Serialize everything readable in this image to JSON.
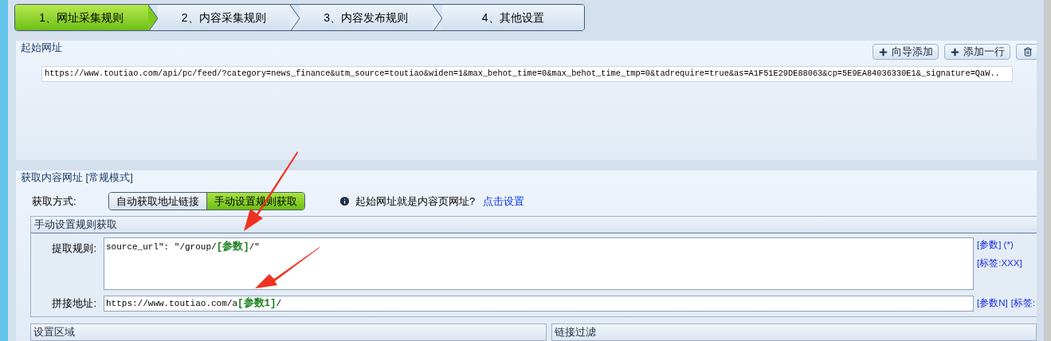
{
  "tabs": [
    {
      "label": "1、网址采集规则",
      "selected": true
    },
    {
      "label": "2、内容采集规则",
      "selected": false
    },
    {
      "label": "3、内容发布规则",
      "selected": false
    },
    {
      "label": "4、其他设置",
      "selected": false
    }
  ],
  "start_urls": {
    "title": "起始网址",
    "buttons": [
      {
        "label": "向导添加",
        "kind": "add"
      },
      {
        "label": "添加一行",
        "kind": "add"
      },
      {
        "kind": "delete"
      }
    ],
    "urls": [
      "https://www.toutiao.com/api/pc/feed/?category=news_finance&utm_source=toutiao&widen=1&max_behot_time=0&max_behot_time_tmp=0&tadrequire=true&as=A1F51E29DE88063&cp=5E9EA84036330E1&_signature=QaW.."
    ]
  },
  "content_urls": {
    "title": "获取内容网址 [常规模式]",
    "method_label": "获取方式:",
    "methods": [
      {
        "label": "自动获取地址链接",
        "selected": false
      },
      {
        "label": "手动设置规则获取",
        "selected": true
      }
    ],
    "hint": "起始网址就是内容页网址?",
    "hint_link": "点击设置",
    "manual": {
      "title": "手动设置规则获取",
      "rule_label": "提取规则:",
      "rule_value": "source_url\": \"/group/**[参数]**/\"",
      "rule_links": [
        "[参数] (*)",
        "[标签:XXX]"
      ],
      "join_label": "拼接地址:",
      "join_value": "https://www.toutiao.com/a**[参数1]**/",
      "join_links": [
        "[参数N]",
        "[标签:"
      ]
    },
    "bottom_panels": [
      "设置区域",
      "链接过滤"
    ]
  }
}
